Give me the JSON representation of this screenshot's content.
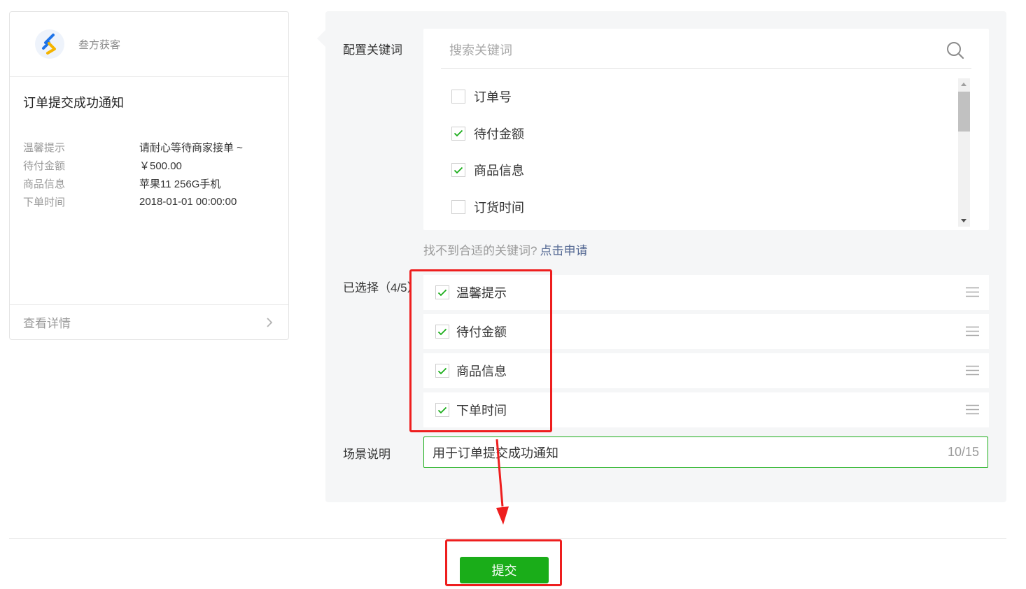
{
  "preview": {
    "brand_name": "叁方获客",
    "title": "订单提交成功通知",
    "rows": [
      {
        "key": "温馨提示",
        "value": "请耐心等待商家接单 ~"
      },
      {
        "key": "待付金额",
        "value": "￥500.00"
      },
      {
        "key": "商品信息",
        "value": "苹果11 256G手机"
      },
      {
        "key": "下单时间",
        "value": "2018-01-01 00:00:00"
      }
    ],
    "detail_label": "查看详情"
  },
  "config": {
    "keywords_label": "配置关键词",
    "search_placeholder": "搜索关键词",
    "keywords": [
      {
        "label": "订单号",
        "checked": false
      },
      {
        "label": "待付金额",
        "checked": true
      },
      {
        "label": "商品信息",
        "checked": true
      },
      {
        "label": "订货时间",
        "checked": false
      }
    ],
    "apply_prompt": "找不到合适的关键词?",
    "apply_link": "点击申请",
    "selected_label": "已选择（4/5）",
    "selected": [
      {
        "label": "温馨提示",
        "checked": true
      },
      {
        "label": "待付金额",
        "checked": true
      },
      {
        "label": "商品信息",
        "checked": true
      },
      {
        "label": "下单时间",
        "checked": true
      }
    ],
    "scene_label": "场景说明",
    "scene_value": "用于订单提交成功通知",
    "scene_count": "10/15"
  },
  "footer": {
    "submit_label": "提交"
  },
  "colors": {
    "accent_green": "#1aad19",
    "link_blue": "#576b95",
    "annotation_red": "#ee1e1e",
    "panel_bg": "#f5f6f7"
  }
}
